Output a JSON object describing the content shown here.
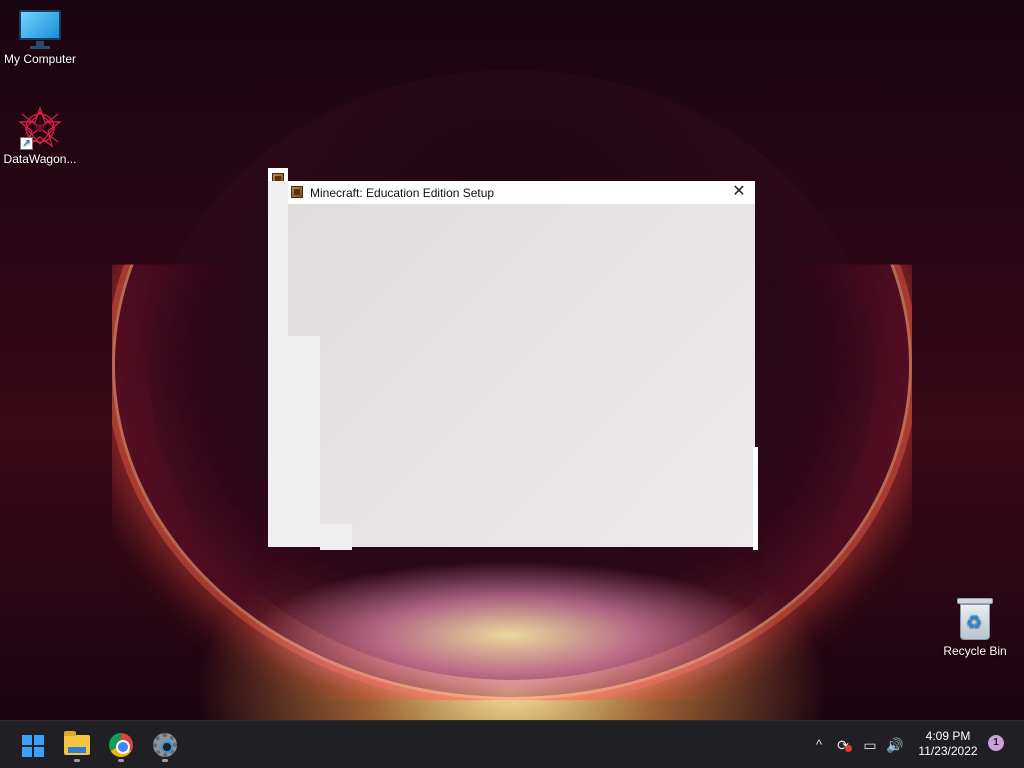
{
  "desktop": {
    "icons": [
      {
        "label": "My Computer",
        "icon": "monitor-icon"
      },
      {
        "label": "DataWagon...",
        "icon": "datawagon-icon"
      },
      {
        "label": "Recycle Bin",
        "icon": "recycle-bin-icon"
      }
    ]
  },
  "setup_window": {
    "title": "Minecraft: Education Edition Setup",
    "close_glyph": "✕",
    "icon": "minecraft-block-icon"
  },
  "taskbar": {
    "apps": [
      {
        "name": "Start",
        "icon": "windows-logo-icon"
      },
      {
        "name": "File Explorer",
        "icon": "folder-icon"
      },
      {
        "name": "Google Chrome",
        "icon": "chrome-icon"
      },
      {
        "name": "Settings",
        "icon": "gear-icon"
      }
    ],
    "tray": {
      "chevron": "^",
      "time": "4:09 PM",
      "date": "11/23/2022",
      "notification_count": "1"
    }
  },
  "colors": {
    "taskbar_bg": "#1f1f24",
    "window_bg": "#f0f0f0",
    "accent": "#3aa0ff"
  }
}
